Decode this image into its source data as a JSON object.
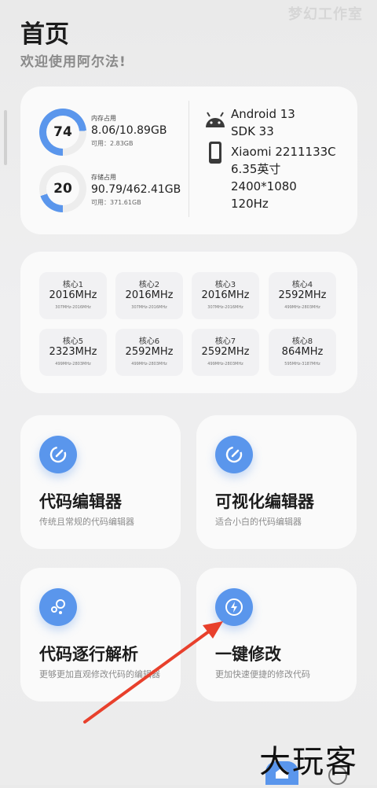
{
  "header": {
    "title": "首页",
    "subtitle": "欢迎使用阿尔法!",
    "watermark_top": "梦幻工作室"
  },
  "memory": {
    "value": "74",
    "percent": 74,
    "label": "内存占用",
    "usage": "8.06/10.89GB",
    "free": "可用：2.83GB"
  },
  "storage": {
    "value": "20",
    "percent": 20,
    "label": "存储占用",
    "usage": "90.79/462.41GB",
    "free": "可用：371.61GB"
  },
  "system": {
    "android": "Android 13",
    "sdk": "SDK 33",
    "device": "Xiaomi 2211133C",
    "screen_size": "6.35英寸",
    "resolution": "2400*1080",
    "refresh": "120Hz"
  },
  "cpu": {
    "cores": [
      {
        "name": "核心1",
        "freq": "2016MHz",
        "range": "307MHz-2016MHz"
      },
      {
        "name": "核心2",
        "freq": "2016MHz",
        "range": "307MHz-2016MHz"
      },
      {
        "name": "核心3",
        "freq": "2016MHz",
        "range": "307MHz-2016MHz"
      },
      {
        "name": "核心4",
        "freq": "2592MHz",
        "range": "499MHz-2803MHz"
      },
      {
        "name": "核心5",
        "freq": "2323MHz",
        "range": "499MHz-2803MHz"
      },
      {
        "name": "核心6",
        "freq": "2592MHz",
        "range": "499MHz-2803MHz"
      },
      {
        "name": "核心7",
        "freq": "2592MHz",
        "range": "499MHz-2803MHz"
      },
      {
        "name": "核心8",
        "freq": "864MHz",
        "range": "595MHz-3187MHz"
      }
    ]
  },
  "tools": [
    {
      "title": "代码编辑器",
      "desc": "传统且常规的代码编辑器",
      "icon": "edit-icon"
    },
    {
      "title": "可视化编辑器",
      "desc": "适合小白的代码编辑器",
      "icon": "edit-icon"
    },
    {
      "title": "代码逐行解析",
      "desc": "更够更加直观修改代码的编辑器",
      "icon": "bubbles-icon"
    },
    {
      "title": "一键修改",
      "desc": "更加快速便捷的修改代码",
      "icon": "lightning-icon"
    }
  ],
  "bottom": {
    "watermark": "大玩客"
  },
  "colors": {
    "accent": "#5a96ec",
    "ring_track": "#ededed",
    "arrow": "#e8402c"
  }
}
